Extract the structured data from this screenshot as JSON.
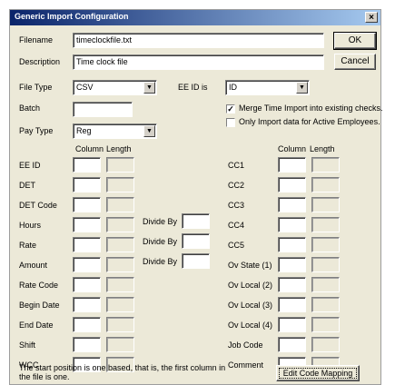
{
  "title": "Generic Import Configuration",
  "close_glyph": "×",
  "labels": {
    "filename": "Filename",
    "description": "Description",
    "file_type": "File Type",
    "ee_id_is": "EE ID is",
    "batch": "Batch",
    "pay_type": "Pay Type",
    "column": "Column",
    "length": "Length",
    "divide_by": "Divide By"
  },
  "fields": {
    "filename": "timeclockfile.txt",
    "description": "Time clock file",
    "file_type": "CSV",
    "ee_id_is": "ID",
    "batch": "",
    "pay_type": "Reg"
  },
  "checkboxes": {
    "merge": {
      "label": "Merge Time Import into existing checks.",
      "checked": true
    },
    "active_only": {
      "label": "Only Import data for Active Employees.",
      "checked": false
    }
  },
  "buttons": {
    "ok": "OK",
    "cancel": "Cancel",
    "edit_code_mapping": "Edit Code Mapping"
  },
  "left_rows": [
    "EE ID",
    "DET",
    "DET Code",
    "Hours",
    "Rate",
    "Amount",
    "Rate Code",
    "Begin Date",
    "End Date",
    "Shift",
    "WCC"
  ],
  "right_rows": [
    "CC1",
    "CC2",
    "CC3",
    "CC4",
    "CC5",
    "Ov State (1)",
    "Ov Local (2)",
    "Ov Local (3)",
    "Ov Local (4)",
    "Job Code",
    "Comment"
  ],
  "note": "The start position is one based, that is, the first column in the file is one."
}
